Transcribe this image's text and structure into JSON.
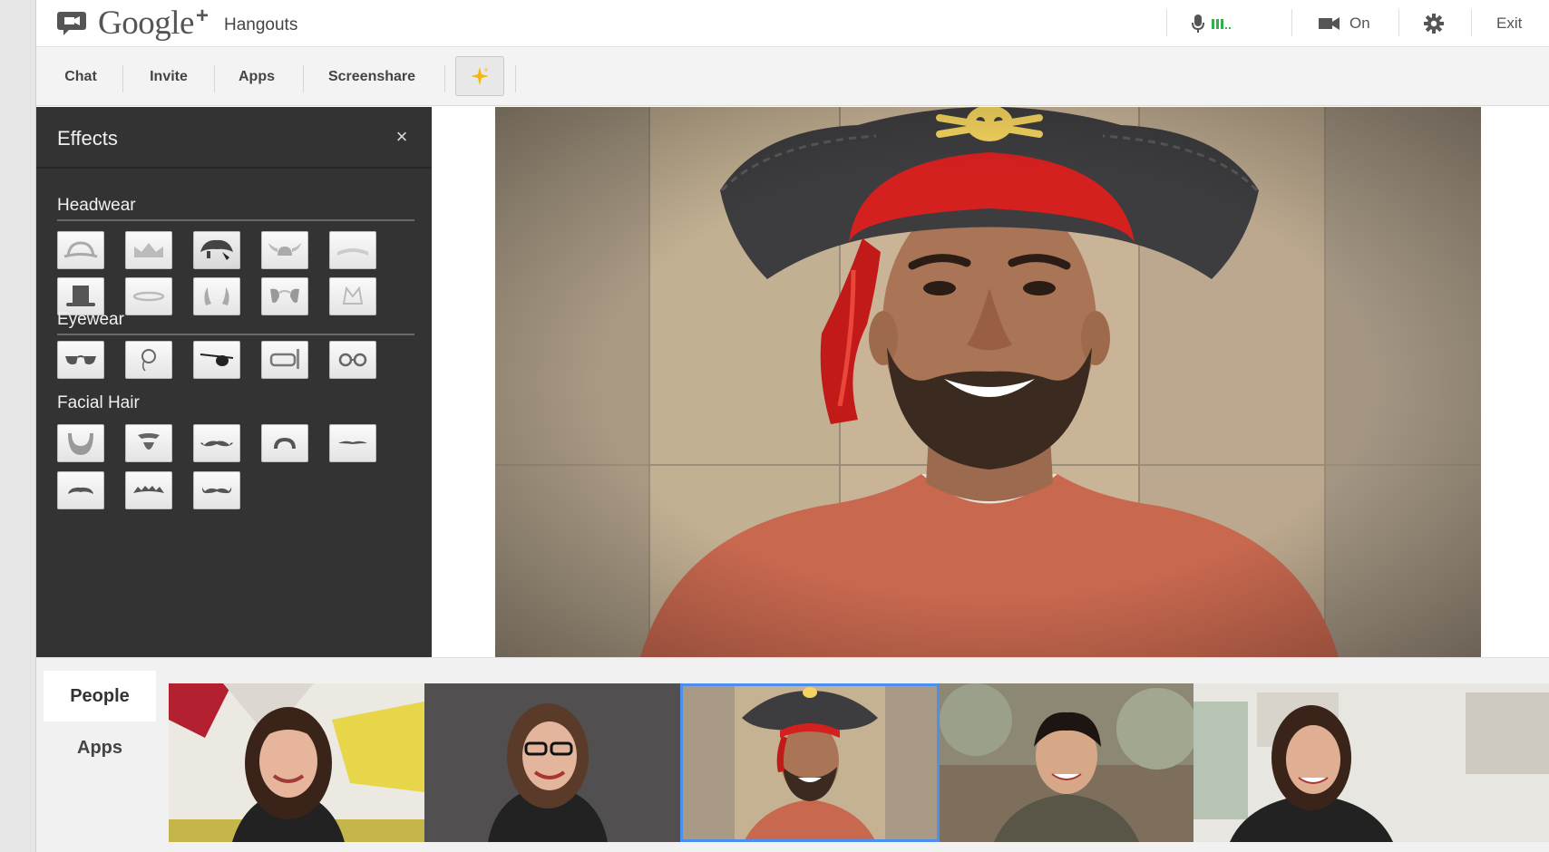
{
  "header": {
    "brand": "Google",
    "brand_plus": "+",
    "app_name": "Hangouts",
    "mic_label": "ııl..",
    "camera_label": "On",
    "exit_label": "Exit"
  },
  "toolbar": {
    "items": [
      {
        "label": "Chat"
      },
      {
        "label": "Invite"
      },
      {
        "label": "Apps"
      },
      {
        "label": "Screenshare"
      }
    ]
  },
  "effects": {
    "title": "Effects",
    "close_glyph": "×",
    "sections": [
      {
        "title": "Headwear",
        "items": [
          "bowler-hat",
          "crown",
          "pirate-hat",
          "viking-helmet",
          "headband",
          "top-hat",
          "halo",
          "devil-horns",
          "dog-ears",
          "cat-ears"
        ]
      },
      {
        "title": "Eyewear",
        "items": [
          "sunglasses",
          "monocle",
          "eye-patch",
          "snorkel-mask",
          "round-glasses"
        ]
      },
      {
        "title": "Facial Hair",
        "items": [
          "full-beard",
          "goatee",
          "handlebar-mustache",
          "horseshoe-mustache",
          "thin-mustache",
          "chevron-mustache",
          "bushy-mustache",
          "curled-mustache"
        ]
      }
    ],
    "selected_item": "pirate-hat"
  },
  "bottom": {
    "tabs": [
      {
        "label": "People",
        "active": true
      },
      {
        "label": "Apps",
        "active": false
      }
    ],
    "participants": [
      {
        "name": "participant-1"
      },
      {
        "name": "participant-2"
      },
      {
        "name": "participant-3",
        "selected": true
      },
      {
        "name": "participant-4"
      },
      {
        "name": "participant-5"
      }
    ]
  },
  "colors": {
    "accent_blue": "#4d8ef0",
    "mic_level_green": "#2fb24a",
    "panel_dark": "#333333",
    "pirate_red": "#d4201f"
  }
}
